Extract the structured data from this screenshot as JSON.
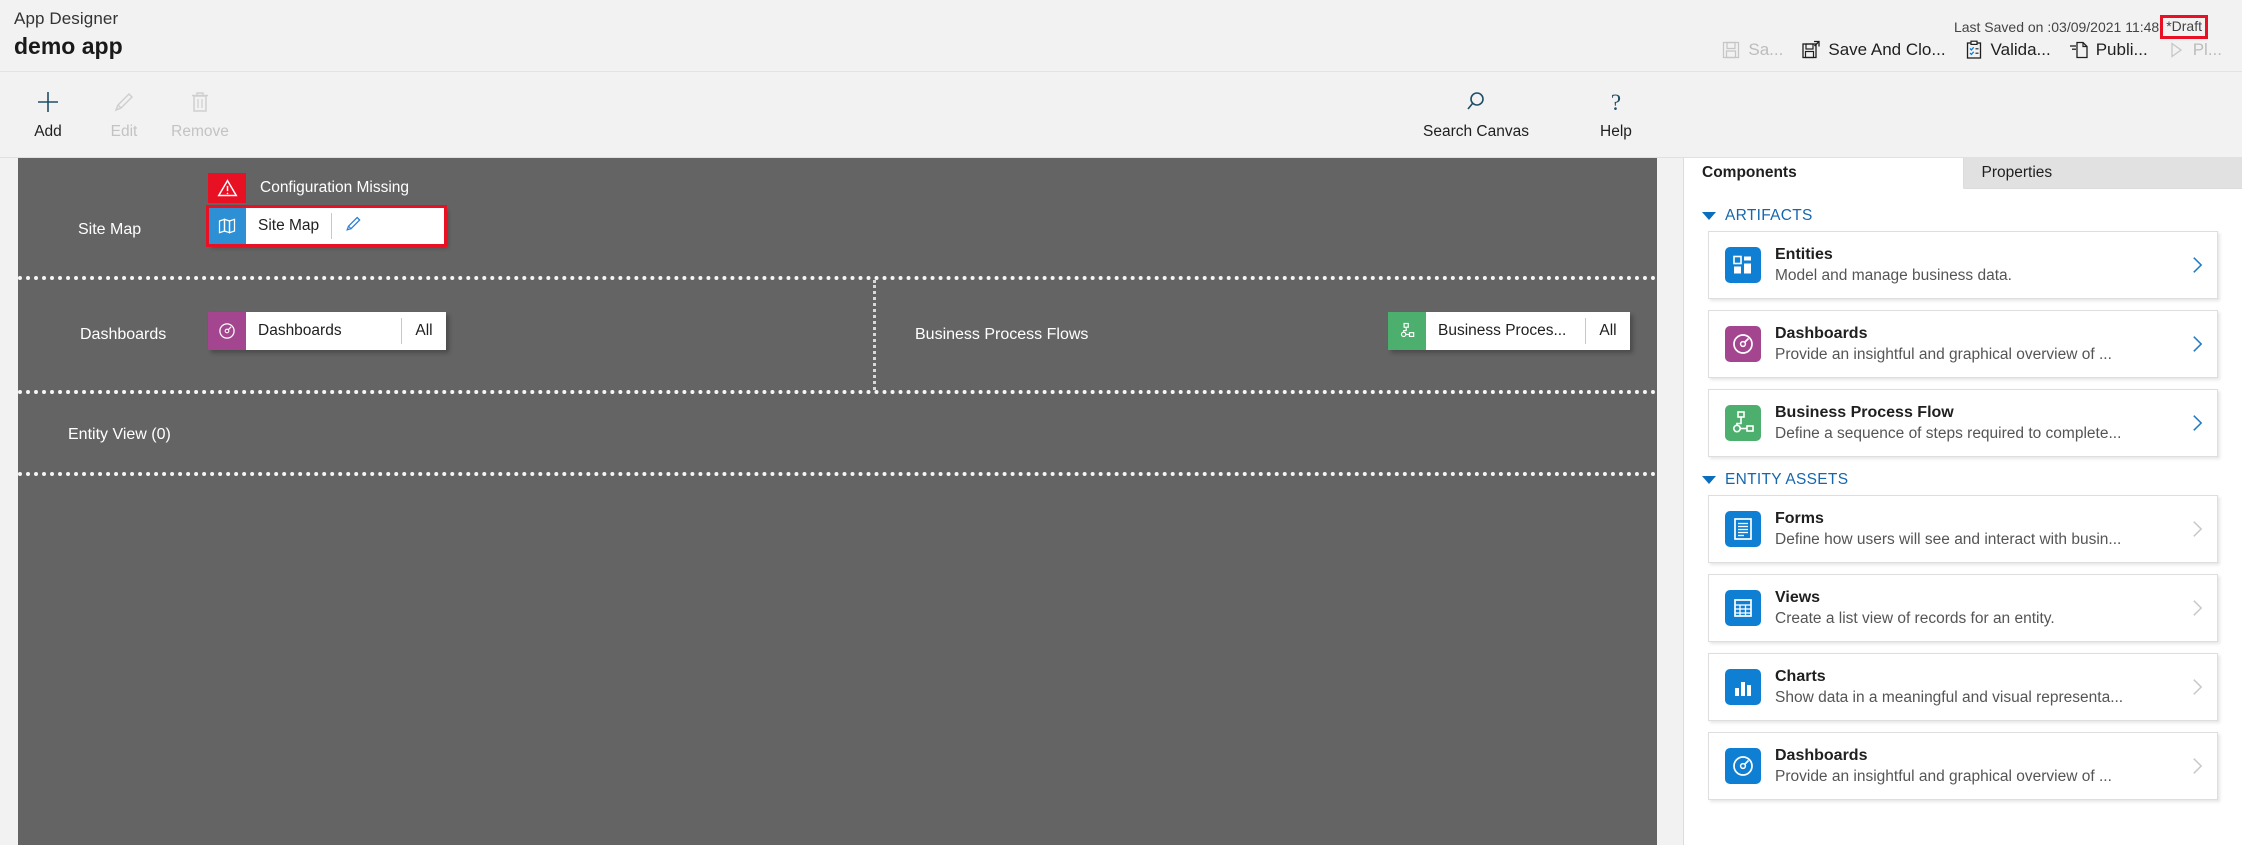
{
  "header": {
    "app_designer_label": "App Designer",
    "app_name": "demo app",
    "last_saved": "Last Saved on :03/09/2021 11:48",
    "draft_status": "*Draft",
    "draft_highlight_color": "#e81123",
    "commands": [
      {
        "label": "Sa...",
        "icon": "save-icon",
        "enabled": false
      },
      {
        "label": "Save And Clo...",
        "icon": "save-and-close-icon",
        "enabled": true
      },
      {
        "label": "Valida...",
        "icon": "validate-clipboard-icon",
        "enabled": true
      },
      {
        "label": "Publi...",
        "icon": "publish-icon",
        "enabled": true
      },
      {
        "label": "Pl...",
        "icon": "play-icon",
        "enabled": false
      }
    ]
  },
  "toolbar": {
    "left": [
      {
        "label": "Add",
        "icon": "plus-icon",
        "enabled": true
      },
      {
        "label": "Edit",
        "icon": "pencil-icon",
        "enabled": false
      },
      {
        "label": "Remove",
        "icon": "trash-icon",
        "enabled": false
      }
    ],
    "right": [
      {
        "label": "Search Canvas",
        "icon": "search-icon",
        "enabled": true
      },
      {
        "label": "Help",
        "icon": "question-mark-icon",
        "enabled": true
      }
    ]
  },
  "canvas": {
    "background_color": "#646464",
    "sitemap_row": {
      "label": "Site Map",
      "warning_text": "Configuration Missing",
      "warning_color": "#e81123",
      "tile": {
        "name": "Site Map",
        "icon": "map-icon",
        "icon_color": "#2d8fd4",
        "edit_icon": "pencil-icon",
        "selected": true
      }
    },
    "dashboards_row": {
      "label": "Dashboards",
      "tile": {
        "name": "Dashboards",
        "trailing": "All",
        "icon": "gauge-icon",
        "icon_color": "#a4458f"
      }
    },
    "bpf_row": {
      "label": "Business Process Flows",
      "tile": {
        "name": "Business Proces...",
        "trailing": "All",
        "icon": "process-flow-icon",
        "icon_color": "#4caf6d"
      }
    },
    "entity_view_row": {
      "label": "Entity View (0)"
    }
  },
  "panel": {
    "tabs": [
      {
        "label": "Components",
        "active": true
      },
      {
        "label": "Properties",
        "active": false
      }
    ],
    "sections": [
      {
        "title": "ARTIFACTS",
        "items": [
          {
            "title": "Entities",
            "desc": "Model and manage business data.",
            "icon": "entities-icon",
            "icon_color": "#0f7fd4",
            "chevron_enabled": true
          },
          {
            "title": "Dashboards",
            "desc": "Provide an insightful and graphical overview of ...",
            "icon": "gauge-icon",
            "icon_color": "#a4458f",
            "chevron_enabled": true
          },
          {
            "title": "Business Process Flow",
            "desc": "Define a sequence of steps required to complete...",
            "icon": "process-flow-icon",
            "icon_color": "#4caf6d",
            "chevron_enabled": true
          }
        ]
      },
      {
        "title": "ENTITY ASSETS",
        "items": [
          {
            "title": "Forms",
            "desc": "Define how users will see and interact with busin...",
            "icon": "form-icon",
            "icon_color": "#0f7fd4",
            "chevron_enabled": false
          },
          {
            "title": "Views",
            "desc": "Create a list view of records for an entity.",
            "icon": "grid-icon",
            "icon_color": "#0f7fd4",
            "chevron_enabled": false
          },
          {
            "title": "Charts",
            "desc": "Show data in a meaningful and visual representa...",
            "icon": "bar-chart-icon",
            "icon_color": "#0f7fd4",
            "chevron_enabled": false
          },
          {
            "title": "Dashboards",
            "desc": "Provide an insightful and graphical overview of ...",
            "icon": "gauge-icon",
            "icon_color": "#0f7fd4",
            "chevron_enabled": false
          }
        ]
      }
    ]
  }
}
